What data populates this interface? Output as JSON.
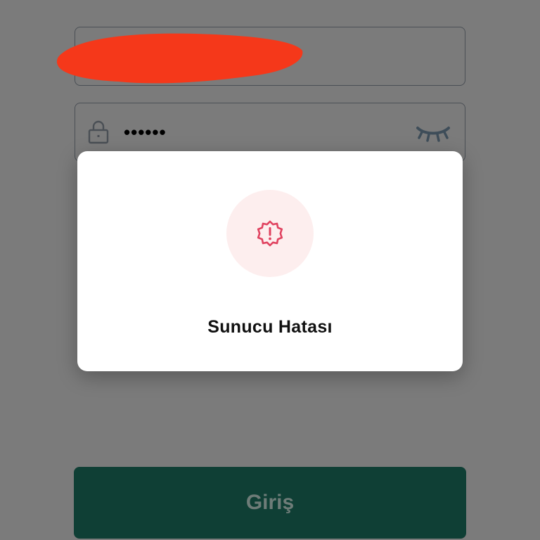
{
  "login_form": {
    "password_mask": "••••••",
    "login_button_label": "Giriş"
  },
  "dialog": {
    "title": "Sunucu Hatası",
    "icon": "error-badge-icon"
  },
  "colors": {
    "overlay_background": "#7b7b7b",
    "redaction": "#f5381a",
    "login_button_bg": "#0f3f35",
    "error_icon": "#e0425f",
    "error_badge_bg": "#fdeeee"
  }
}
